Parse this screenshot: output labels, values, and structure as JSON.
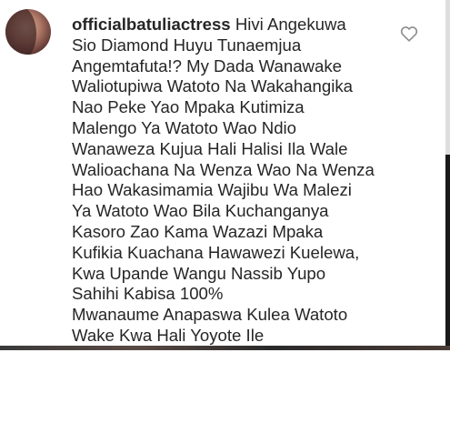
{
  "comment": {
    "username": "officialbatuliactress",
    "lines": [
      "Hivi Angekuwa",
      "Sio Diamond Huyu Tunaemjua",
      "Angemtafuta!? My Dada Wanawake",
      "Waliotupiwa Watoto Na Wakahangika",
      "Nao Peke Yao Mpaka Kutimiza",
      "Malengo Ya Watoto Wao Ndio",
      "Wanaweza Kujua Hali Halisi Ila Wale",
      "Walioachana Na Wenza Wao Na Wenza",
      "Hao Wakasimamia Wajibu Wa Malezi",
      "Ya Watoto Wao Bila Kuchanganya",
      "Kasoro Zao Kama Wazazi Mpaka",
      "Kufikia Kuachana Hawawezi Kuelewa,",
      "Kwa Upande Wangu Nassib Yupo",
      "Sahihi Kabisa 100%",
      "Mwanaume Anapaswa Kulea Watoto",
      "Wake Kwa Hali Yoyote Ile"
    ]
  },
  "icons": {
    "like": "heart-outline-icon",
    "avatar": "profile-photo"
  },
  "colors": {
    "text": "#262626",
    "heart_stroke": "#8e8e8e",
    "background": "#ffffff"
  }
}
